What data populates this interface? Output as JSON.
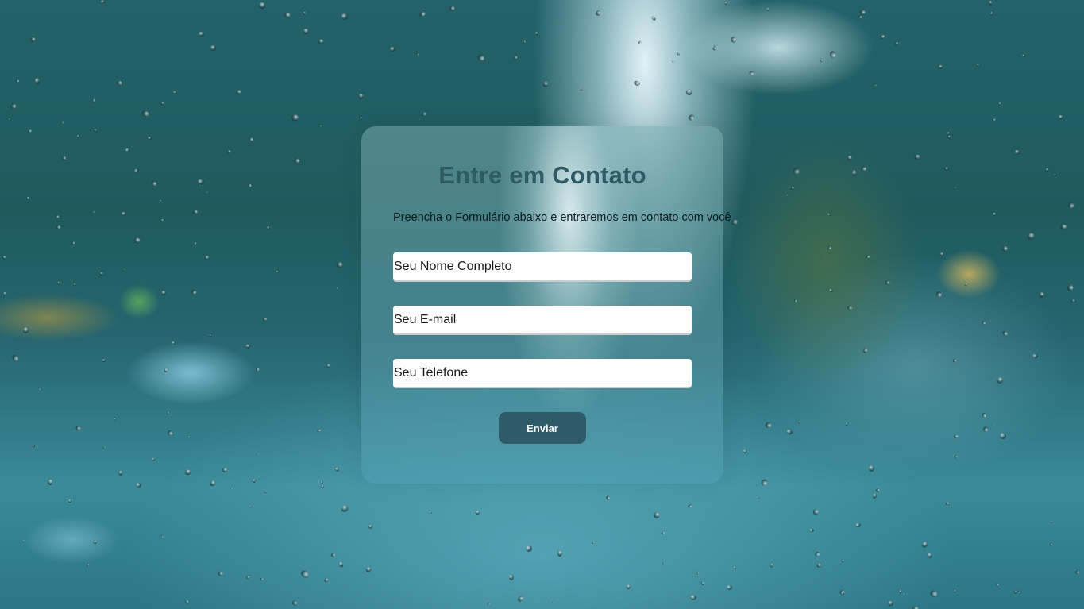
{
  "form": {
    "title": "Entre em Contato",
    "subtitle": "Preencha o Formulário abaixo e entraremos em contato com você",
    "fields": {
      "name_placeholder": "Seu Nome Completo",
      "email_placeholder": "Seu E-mail",
      "phone_placeholder": "Seu Telefone"
    },
    "submit_label": "Enviar"
  },
  "colors": {
    "accent": "#2f5a68",
    "field_background": "#ffffff",
    "submit_text": "#ffffff"
  }
}
